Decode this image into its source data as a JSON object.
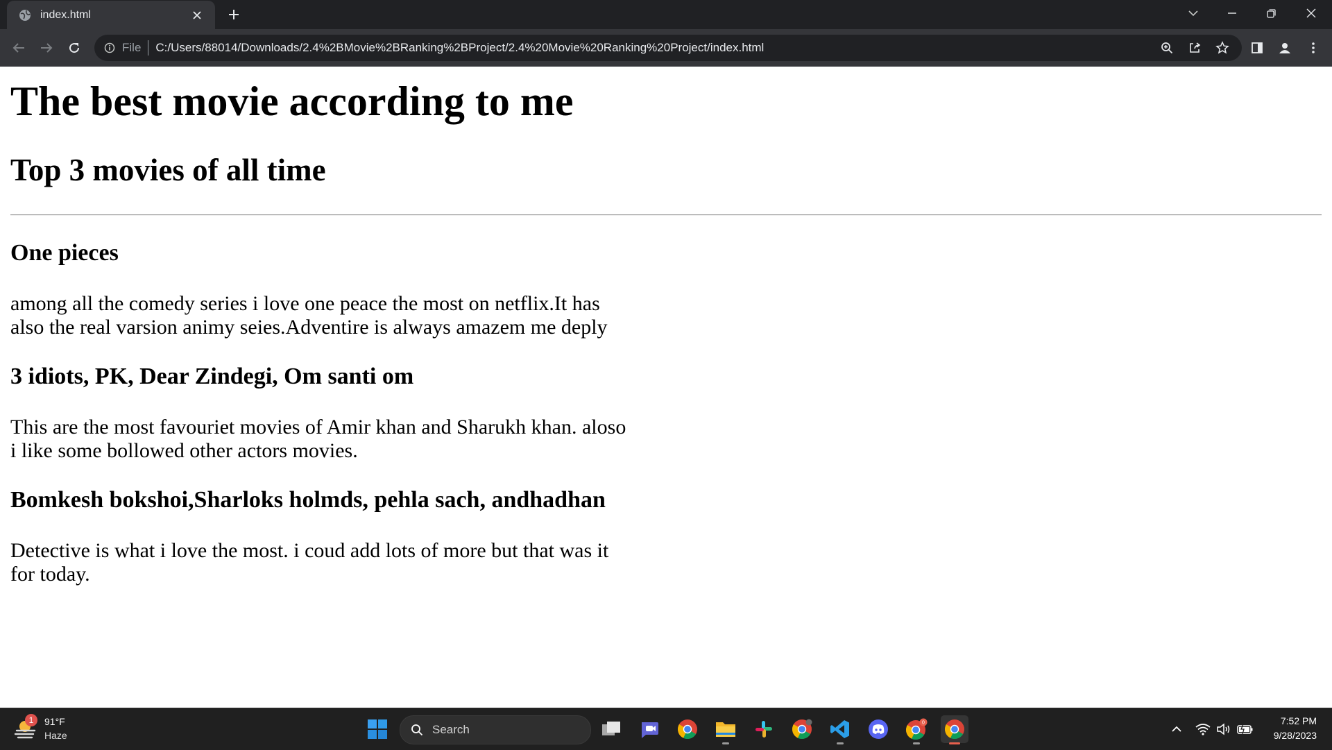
{
  "browser": {
    "tab_title": "index.html",
    "scheme_label": "File",
    "url": "C:/Users/88014/Downloads/2.4%2BMovie%2BRanking%2BProject/2.4%20Movie%20Ranking%20Project/index.html"
  },
  "page": {
    "heading": "The best movie according to me",
    "subheading": "Top 3 movies of all time",
    "sections": [
      {
        "title": "One pieces",
        "text": "among all the comedy series i love one peace the most on netflix.It has also the real varsion animy seies.Adventire is always amazem me deply"
      },
      {
        "title": "3 idiots, PK, Dear Zindegi, Om santi om",
        "text": "This are the most favouriet movies of Amir khan and Sharukh khan. aloso i like some bollowed other actors movies."
      },
      {
        "title": "Bomkesh bokshoi,Sharloks holmds, pehla sach, andhadhan",
        "text": "Detective is what i love the most. i coud add lots of more but that was it for today."
      }
    ]
  },
  "taskbar": {
    "weather_badge": "1",
    "weather_temp": "91°F",
    "weather_condition": "Haze",
    "search_placeholder": "Search",
    "clock_time": "7:52 PM",
    "clock_date": "9/28/2023",
    "chrome_profile_badge": "0"
  },
  "colors": {
    "chrome_dark": "#202124",
    "chrome_toolbar": "#35363a",
    "taskbar": "#202020",
    "accent_windows": "#2f9ae8"
  }
}
